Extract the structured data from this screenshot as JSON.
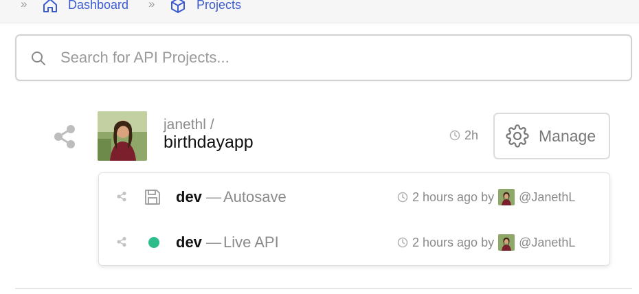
{
  "breadcrumb": {
    "separator": "»",
    "items": [
      {
        "label": "Dashboard",
        "icon": "home-icon"
      },
      {
        "label": "Projects",
        "icon": "cube-icon"
      }
    ]
  },
  "search": {
    "placeholder": "Search for API Projects...",
    "value": "",
    "icon": "search-icon"
  },
  "project": {
    "owner": "janethl /",
    "name": "birthdayapp",
    "updated": "2h",
    "manage_label": "Manage",
    "versions": [
      {
        "env": "dev",
        "dash": "—",
        "kind": "Autosave",
        "time": "2 hours ago by",
        "user": "@JanethL",
        "state_icon": "save-icon"
      },
      {
        "env": "dev",
        "dash": "—",
        "kind": "Live API",
        "time": "2 hours ago by",
        "user": "@JanethL",
        "state_icon": "live-status-dot"
      }
    ]
  },
  "colors": {
    "link": "#3a5bd0",
    "live": "#2dbd8a",
    "muted": "#8a8a8a"
  }
}
